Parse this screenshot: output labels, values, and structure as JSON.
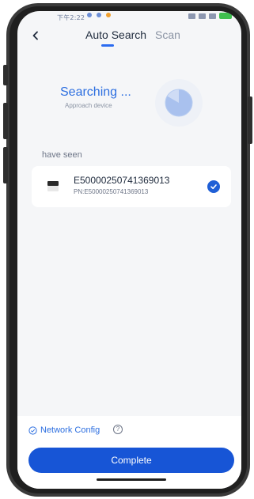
{
  "status_bar": {
    "time": "下午2:22"
  },
  "header": {
    "tabs": [
      {
        "label": "Auto Search",
        "active": true
      },
      {
        "label": "Scan",
        "active": false
      }
    ]
  },
  "search_status": {
    "title": "Searching ...",
    "subtitle": "Approach device"
  },
  "list": {
    "section_label": "have seen",
    "devices": [
      {
        "name": "E50000250741369013",
        "pn": "PN:E50000250741369013",
        "selected": true
      }
    ]
  },
  "footer": {
    "network_config_label": "Network Config",
    "complete_label": "Complete"
  },
  "colors": {
    "accent": "#2d6fe0",
    "button": "#1755d6",
    "background": "#f5f6f8"
  }
}
